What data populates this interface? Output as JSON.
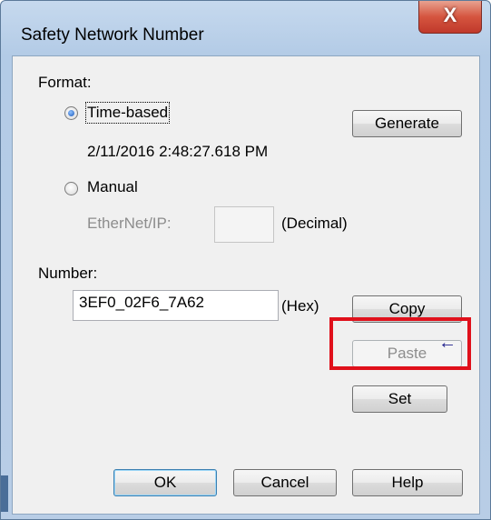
{
  "window": {
    "title": "Safety Network Number",
    "close_glyph": "X"
  },
  "format": {
    "label": "Format:",
    "time_based": {
      "label": "Time-based",
      "checked": true,
      "value": "2/11/2016 2:48:27.618 PM"
    },
    "manual": {
      "label": "Manual",
      "checked": false
    },
    "ethernet_label": "EtherNet/IP:",
    "ethernet_value": "",
    "decimal_suffix": "(Decimal)",
    "generate_label": "Generate"
  },
  "number": {
    "label": "Number:",
    "value": "3EF0_02F6_7A62",
    "hex_suffix": "(Hex)",
    "copy_label": "Copy",
    "paste_label": "Paste",
    "set_label": "Set"
  },
  "footer": {
    "ok_label": "OK",
    "cancel_label": "Cancel",
    "help_label": "Help"
  },
  "annotation": {
    "arrow_glyph": "←",
    "highlight_color": "#e0101b"
  }
}
